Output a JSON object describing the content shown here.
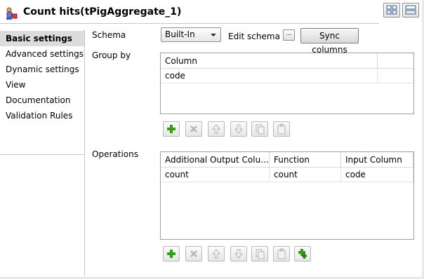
{
  "window": {
    "title": "Count hits(tPigAggregate_1)",
    "icon": "pig-aggregate-component-icon"
  },
  "header_buttons": [
    {
      "name": "form-view-toggle-button",
      "icon": "grid-layout-icon"
    },
    {
      "name": "table-view-toggle-button",
      "icon": "list-layout-icon"
    }
  ],
  "sidebar": {
    "items": [
      {
        "label": "Basic settings",
        "active": true
      },
      {
        "label": "Advanced settings",
        "active": false
      },
      {
        "label": "Dynamic settings",
        "active": false
      },
      {
        "label": "View",
        "active": false
      },
      {
        "label": "Documentation",
        "active": false
      },
      {
        "label": "Validation Rules",
        "active": false
      }
    ]
  },
  "schema": {
    "label": "Schema",
    "selected": "Built-In",
    "edit_label": "Edit schema",
    "ellipsis_label": "...",
    "sync_label": "Sync columns"
  },
  "group_by": {
    "label": "Group by",
    "columns": [
      "Column"
    ],
    "rows": [
      [
        "code"
      ]
    ]
  },
  "operations": {
    "label": "Operations",
    "columns": [
      "Additional Output Colu...",
      "Function",
      "Input Column"
    ],
    "rows": [
      [
        "count",
        "count",
        "code"
      ]
    ]
  },
  "toolbar_icons": {
    "add": "add-row-icon",
    "remove": "remove-row-icon",
    "up": "move-up-icon",
    "down": "move-down-icon",
    "copy": "copy-icon",
    "paste": "paste-icon",
    "add_all": "add-all-icon"
  },
  "colors": {
    "active_sidebar_bg": "#dcdcdc",
    "add_icon_green": "#3a9a1e",
    "border": "#a0a0a0"
  }
}
